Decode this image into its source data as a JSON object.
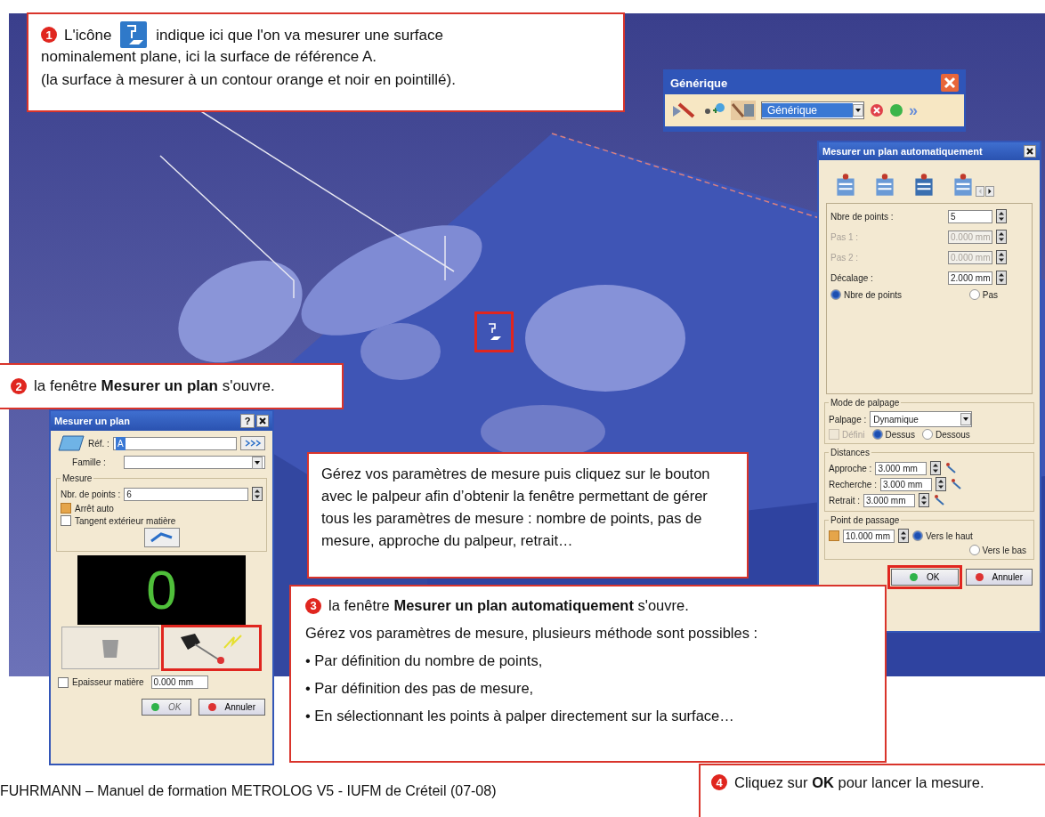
{
  "callout_1": {
    "number": "1",
    "before_icon": "L'icône",
    "after_icon": "indique ici que l'on va mesurer une surface",
    "continuation": "nominalement plane, ici la surface de référence A.",
    "note": "(la surface à mesurer à un contour orange et noir en pointillé)."
  },
  "toolbar": {
    "title": "Générique",
    "dropdown": "Générique",
    "more": "»"
  },
  "auto_dialog": {
    "title": "Mesurer un plan automatiquement",
    "fields": [
      {
        "label": "Nbre de points :",
        "value": "5",
        "disabled": false
      },
      {
        "label": "Pas 1 :",
        "value": "0.000 mm",
        "disabled": true
      },
      {
        "label": "Pas 2 :",
        "value": "0.000 mm",
        "disabled": true
      },
      {
        "label": "Décalage :",
        "value": "2.000 mm",
        "disabled": false
      }
    ],
    "mode_radios": [
      {
        "label": "Nbre de points",
        "selected": true
      },
      {
        "label": "Pas",
        "selected": false
      }
    ],
    "probing": {
      "legend": "Mode de palpage",
      "label": "Palpage :",
      "value": "Dynamique",
      "check": {
        "label": "Défini",
        "disabled": true
      },
      "radios": [
        {
          "label": "Dessus",
          "selected": true
        },
        {
          "label": "Dessous",
          "selected": false
        }
      ]
    },
    "distances": {
      "legend": "Distances",
      "rows": [
        {
          "label": "Approche :",
          "value": "3.000 mm"
        },
        {
          "label": "Recherche :",
          "value": "3.000 mm"
        },
        {
          "label": "Retrait :",
          "value": "3.000 mm"
        }
      ]
    },
    "passage": {
      "legend": "Point de passage",
      "checked": true,
      "value": "10.000 mm",
      "radios": [
        {
          "label": "Vers le haut",
          "selected": true
        },
        {
          "label": "Vers le bas",
          "selected": false
        }
      ]
    },
    "ok": "OK",
    "cancel": "Annuler"
  },
  "callout_2": {
    "number": "2",
    "text": "la fenêtre **Mesurer un plan** s'ouvre."
  },
  "plane_dialog": {
    "title": "Mesurer un plan",
    "help": "?",
    "ref_label": "Réf. :",
    "ref_value": "A",
    "family_label": "Famille :",
    "legend": "Mesure",
    "points_label": "Nbr. de points :",
    "points_value": "6",
    "checks": [
      {
        "label": "Arrêt auto",
        "checked": true
      },
      {
        "label": "Tangent extérieur matière",
        "checked": false
      }
    ],
    "counter": "0",
    "thickness": {
      "label": "Epaisseur matière",
      "checked": false,
      "value": "0.000 mm"
    },
    "ok": {
      "label": "OK",
      "disabled": true
    },
    "cancel": "Annuler"
  },
  "hint": "Gérez vos paramètres de mesure puis cliquez sur le bouton avec le palpeur afin d’obtenir la fenêtre permettant de gérer tous les paramètres de mesure : nombre de points, pas de mesure, approche du palpeur, retrait…",
  "callout_3": {
    "number": "3",
    "title": "la fenêtre **Mesurer un plan automatiquement** s'ouvre.",
    "intro": "Gérez vos paramètres de mesure, plusieurs méthode sont possibles :",
    "bullets": [
      "• Par définition du nombre de points,",
      "• Par définition des pas de mesure,",
      "• En sélectionnant les points à palper directement sur la surface…"
    ]
  },
  "callout_4": {
    "number": "4",
    "text": "Cliquez sur **OK** pour lancer la mesure."
  },
  "footer": "FUHRMANN – Manuel de formation METROLOG V5 - IUFM de Créteil (07-08)"
}
